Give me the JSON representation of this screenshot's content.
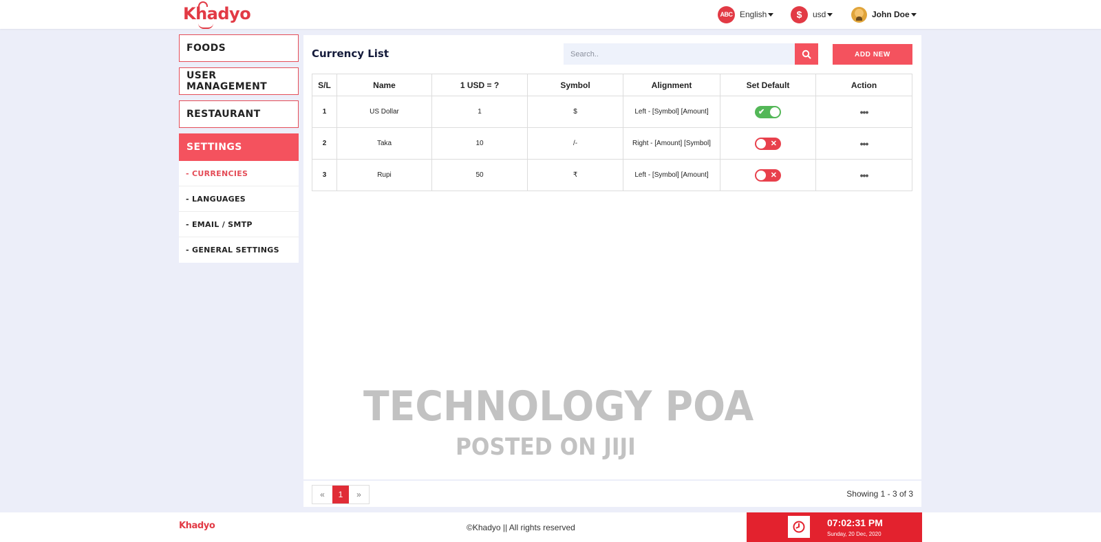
{
  "header": {
    "logo": "Khadyo",
    "language": {
      "icon_text": "ABC",
      "label": "English"
    },
    "currency": {
      "icon_text": "$",
      "label": "usd"
    },
    "user": {
      "name": "John Doe"
    }
  },
  "sidebar": {
    "items": [
      {
        "label": "FOODS",
        "active": false
      },
      {
        "label": "USER MANAGEMENT",
        "active": false
      },
      {
        "label": "RESTAURANT",
        "active": false
      },
      {
        "label": "SETTINGS",
        "active": true
      }
    ],
    "sub_items": [
      {
        "label": "- CURRENCIES",
        "active": true
      },
      {
        "label": "- LANGUAGES",
        "active": false
      },
      {
        "label": "- EMAIL / SMTP",
        "active": false
      },
      {
        "label": "- GENERAL SETTINGS",
        "active": false
      }
    ]
  },
  "main": {
    "title": "Currency List",
    "search": {
      "placeholder": "Search..",
      "value": ""
    },
    "add_button": "ADD NEW",
    "table": {
      "columns": [
        "S/L",
        "Name",
        "1 USD = ?",
        "Symbol",
        "Alignment",
        "Set Default",
        "Action"
      ],
      "rows": [
        {
          "sl": "1",
          "name": "US Dollar",
          "rate": "1",
          "symbol": "$",
          "alignment": "Left - [Symbol] [Amount]",
          "default": true,
          "action": "•••"
        },
        {
          "sl": "2",
          "name": "Taka",
          "rate": "10",
          "symbol": "/-",
          "alignment": "Right - [Amount] [Symbol]",
          "default": false,
          "action": "•••"
        },
        {
          "sl": "3",
          "name": "Rupi",
          "rate": "50",
          "symbol": "₹",
          "alignment": "Left - [Symbol] [Amount]",
          "default": false,
          "action": "•••"
        }
      ]
    },
    "watermark": {
      "line1": "TECHNOLOGY POA",
      "line2": "POSTED ON JIJI"
    }
  },
  "pagination": {
    "prev": "«",
    "current": "1",
    "next": "»",
    "showing": "Showing 1 - 3 of 3"
  },
  "footer": {
    "logo": "Khadyo",
    "copyright": "©Khadyo || All rights reserved",
    "time": "07:02:31 PM",
    "date": "Sunday, 20 Dec, 2020"
  },
  "colors": {
    "accent": "#f4525e",
    "accent_dark": "#e3222e",
    "toggle_on": "#53b757",
    "toggle_off": "#e8404c",
    "background": "#eceef9"
  }
}
